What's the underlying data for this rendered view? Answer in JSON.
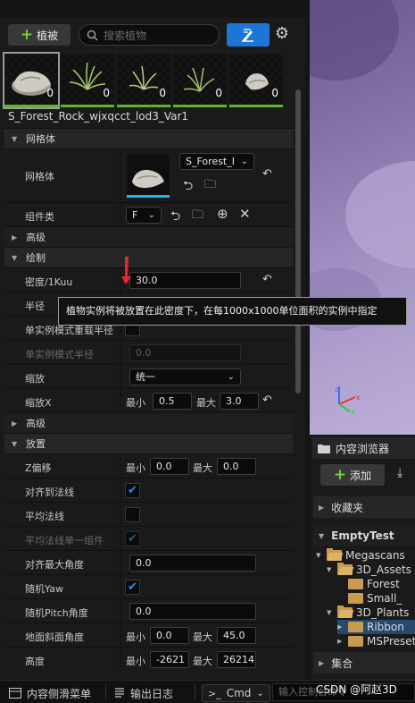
{
  "toolbar": {
    "add_label": "植被",
    "search_placeholder": "搜索植物"
  },
  "thumbnails": [
    {
      "name": "rock-foliage",
      "count": "0"
    },
    {
      "name": "grass-foliage-1",
      "count": "0"
    },
    {
      "name": "grass-foliage-2",
      "count": "0"
    },
    {
      "name": "grass-foliage-3",
      "count": "0"
    },
    {
      "name": "rock-foliage-2",
      "count": "0"
    }
  ],
  "asset_name": "S_Forest_Rock_wjxqcct_lod3_Var1",
  "sections": {
    "mesh": "网格体",
    "advanced1": "高级",
    "paint": "绘制",
    "advanced2": "高级",
    "placement": "放置"
  },
  "mesh": {
    "mesh_label": "网格体",
    "mesh_value": "S_Forest_I",
    "component_label": "组件类",
    "component_value": "F"
  },
  "paint": {
    "density_label": "密度/1Kuu",
    "density_value": "30.0",
    "radius_label": "半径",
    "single_override_label": "单实例模式重载半径",
    "single_radius_label": "单实例模式半径",
    "single_radius_value": "0.0",
    "scale_label": "缩放",
    "scale_value": "统一",
    "scalex_label": "缩放X",
    "min_label": "最小",
    "max_label": "最大",
    "scalex_min": "0.5",
    "scalex_max": "3.0"
  },
  "tooltip": "植物实例将被放置在此密度下，在每1000x1000单位面积的实例中指定",
  "placement": {
    "zoffset_label": "Z偏移",
    "zoffset_min": "0.0",
    "zoffset_max": "0.0",
    "align_normal_label": "对齐到法线",
    "avg_normal_label": "平均法线",
    "avg_normal_single_label": "平均法线单一组件",
    "align_max_angle_label": "对齐最大角度",
    "align_max_angle_value": "0.0",
    "random_yaw_label": "随机Yaw",
    "random_pitch_label": "随机Pitch角度",
    "random_pitch_value": "0.0",
    "ground_slope_label": "地面斜面角度",
    "ground_slope_min": "0.0",
    "ground_slope_max": "45.0",
    "height_label": "高度",
    "height_min": "-2621",
    "height_max": "26214"
  },
  "content_browser": {
    "tab_label": "内容浏览器",
    "add_label": "添加",
    "favorites_label": "收藏夹",
    "project_label": "EmptyTest",
    "collections_label": "集合",
    "tree": [
      {
        "label": "Megascans",
        "depth": 0
      },
      {
        "label": "3D_Assets",
        "depth": 1
      },
      {
        "label": "Forest",
        "depth": 2
      },
      {
        "label": "Small_",
        "depth": 2
      },
      {
        "label": "3D_Plants",
        "depth": 1
      },
      {
        "label": "Ribbon",
        "depth": 2
      },
      {
        "label": "MSPresets",
        "depth": 0
      }
    ]
  },
  "bottom_bar": {
    "drawer_label": "内容侧滑菜单",
    "output_log_label": "输出日志",
    "cmd_label": "Cmd",
    "console_placeholder": "输入控制台命令"
  },
  "watermark": "CSDN @阿赵3D",
  "colors": {
    "accent_blue": "#1b76d6",
    "plus_green": "#6fd23f",
    "folder": "#c99a4f",
    "viewport_purple": "#9e8cc0"
  }
}
